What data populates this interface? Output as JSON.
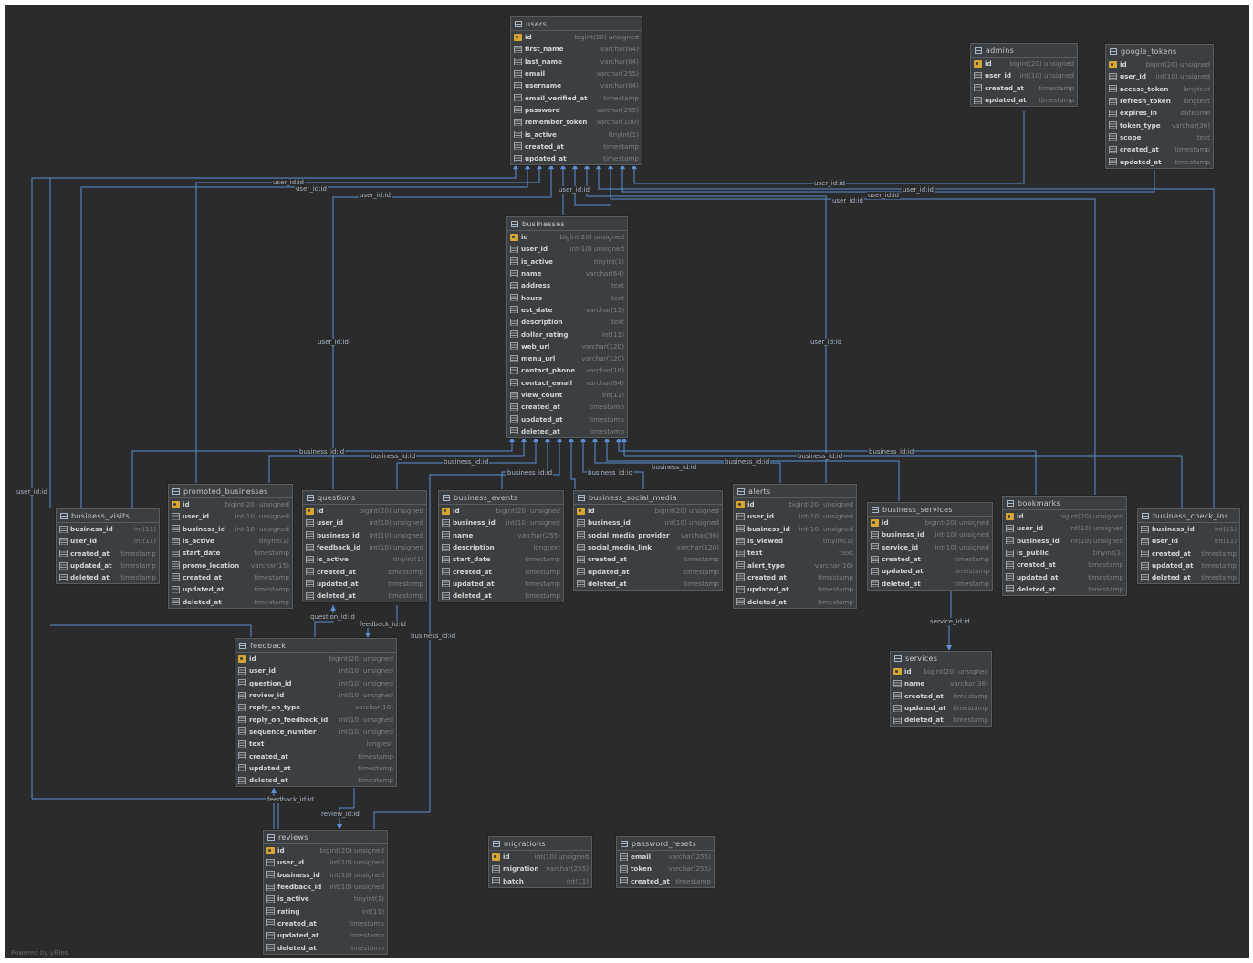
{
  "tables": [
    {
      "key": "users",
      "name": "users",
      "columns": [
        [
          "id",
          "bigint(20) unsigned"
        ],
        [
          "first_name",
          "varchar(64)"
        ],
        [
          "last_name",
          "varchar(64)"
        ],
        [
          "email",
          "varchar(255)"
        ],
        [
          "username",
          "varchar(64)"
        ],
        [
          "email_verified_at",
          "timestamp"
        ],
        [
          "password",
          "varchar(255)"
        ],
        [
          "remember_token",
          "varchar(100)"
        ],
        [
          "is_active",
          "tinyint(1)"
        ],
        [
          "created_at",
          "timestamp"
        ],
        [
          "updated_at",
          "timestamp"
        ]
      ]
    },
    {
      "key": "admins",
      "name": "admins",
      "columns": [
        [
          "id",
          "bigint(20) unsigned"
        ],
        [
          "user_id",
          "int(10) unsigned"
        ],
        [
          "created_at",
          "timestamp"
        ],
        [
          "updated_at",
          "timestamp"
        ]
      ]
    },
    {
      "key": "google_tokens",
      "name": "google_tokens",
      "columns": [
        [
          "id",
          "bigint(20) unsigned"
        ],
        [
          "user_id",
          "int(10) unsigned"
        ],
        [
          "access_token",
          "longtext"
        ],
        [
          "refresh_token",
          "longtext"
        ],
        [
          "expires_in",
          "datetime"
        ],
        [
          "token_type",
          "varchar(36)"
        ],
        [
          "scope",
          "text"
        ],
        [
          "created_at",
          "timestamp"
        ],
        [
          "updated_at",
          "timestamp"
        ]
      ]
    },
    {
      "key": "businesses",
      "name": "businesses",
      "columns": [
        [
          "id",
          "bigint(20) unsigned"
        ],
        [
          "user_id",
          "int(10) unsigned"
        ],
        [
          "is_active",
          "tinyint(1)"
        ],
        [
          "name",
          "varchar(64)"
        ],
        [
          "address",
          "text"
        ],
        [
          "hours",
          "text"
        ],
        [
          "est_date",
          "varchar(15)"
        ],
        [
          "description",
          "text"
        ],
        [
          "dollar_rating",
          "int(11)"
        ],
        [
          "web_url",
          "varchar(120)"
        ],
        [
          "menu_url",
          "varchar(120)"
        ],
        [
          "contact_phone",
          "varchar(18)"
        ],
        [
          "contact_email",
          "varchar(64)"
        ],
        [
          "view_count",
          "int(11)"
        ],
        [
          "created_at",
          "timestamp"
        ],
        [
          "updated_at",
          "timestamp"
        ],
        [
          "deleted_at",
          "timestamp"
        ]
      ]
    },
    {
      "key": "business_visits",
      "name": "business_visits",
      "columns": [
        [
          "business_id",
          "int(11)"
        ],
        [
          "user_id",
          "int(11)"
        ],
        [
          "created_at",
          "timestamp"
        ],
        [
          "updated_at",
          "timestamp"
        ],
        [
          "deleted_at",
          "timestamp"
        ]
      ]
    },
    {
      "key": "promoted_businesses",
      "name": "promoted_businesses",
      "columns": [
        [
          "id",
          "bigint(20) unsigned"
        ],
        [
          "user_id",
          "int(10) unsigned"
        ],
        [
          "business_id",
          "int(10) unsigned"
        ],
        [
          "is_active",
          "tinyint(1)"
        ],
        [
          "start_date",
          "timestamp"
        ],
        [
          "promo_location",
          "varchar(15)"
        ],
        [
          "created_at",
          "timestamp"
        ],
        [
          "updated_at",
          "timestamp"
        ],
        [
          "deleted_at",
          "timestamp"
        ]
      ]
    },
    {
      "key": "questions",
      "name": "questions",
      "columns": [
        [
          "id",
          "bigint(20) unsigned"
        ],
        [
          "user_id",
          "int(10) unsigned"
        ],
        [
          "business_id",
          "int(10) unsigned"
        ],
        [
          "feedback_id",
          "int(10) unsigned"
        ],
        [
          "is_active",
          "tinyint(1)"
        ],
        [
          "created_at",
          "timestamp"
        ],
        [
          "updated_at",
          "timestamp"
        ],
        [
          "deleted_at",
          "timestamp"
        ]
      ]
    },
    {
      "key": "business_events",
      "name": "business_events",
      "columns": [
        [
          "id",
          "bigint(20) unsigned"
        ],
        [
          "business_id",
          "int(10) unsigned"
        ],
        [
          "name",
          "varchar(255)"
        ],
        [
          "description",
          "longtext"
        ],
        [
          "start_date",
          "timestamp"
        ],
        [
          "created_at",
          "timestamp"
        ],
        [
          "updated_at",
          "timestamp"
        ],
        [
          "deleted_at",
          "timestamp"
        ]
      ]
    },
    {
      "key": "business_social_media",
      "name": "business_social_media",
      "columns": [
        [
          "id",
          "bigint(20) unsigned"
        ],
        [
          "business_id",
          "int(10) unsigned"
        ],
        [
          "social_media_provider",
          "varchar(36)"
        ],
        [
          "social_media_link",
          "varchar(120)"
        ],
        [
          "created_at",
          "timestamp"
        ],
        [
          "updated_at",
          "timestamp"
        ],
        [
          "deleted_at",
          "timestamp"
        ]
      ]
    },
    {
      "key": "alerts",
      "name": "alerts",
      "columns": [
        [
          "id",
          "bigint(20) unsigned"
        ],
        [
          "user_id",
          "int(10) unsigned"
        ],
        [
          "business_id",
          "int(10) unsigned"
        ],
        [
          "is_viewed",
          "tinyint(1)"
        ],
        [
          "text",
          "text"
        ],
        [
          "alert_type",
          "varchar(16)"
        ],
        [
          "created_at",
          "timestamp"
        ],
        [
          "updated_at",
          "timestamp"
        ],
        [
          "deleted_at",
          "timestamp"
        ]
      ]
    },
    {
      "key": "business_services",
      "name": "business_services",
      "columns": [
        [
          "id",
          "bigint(20) unsigned"
        ],
        [
          "business_id",
          "int(10) unsigned"
        ],
        [
          "service_id",
          "int(10) unsigned"
        ],
        [
          "created_at",
          "timestamp"
        ],
        [
          "updated_at",
          "timestamp"
        ],
        [
          "deleted_at",
          "timestamp"
        ]
      ]
    },
    {
      "key": "bookmarks",
      "name": "bookmarks",
      "columns": [
        [
          "id",
          "bigint(20) unsigned"
        ],
        [
          "user_id",
          "int(10) unsigned"
        ],
        [
          "business_id",
          "int(10) unsigned"
        ],
        [
          "is_public",
          "tinyint(1)"
        ],
        [
          "created_at",
          "timestamp"
        ],
        [
          "updated_at",
          "timestamp"
        ],
        [
          "deleted_at",
          "timestamp"
        ]
      ]
    },
    {
      "key": "business_check_ins",
      "name": "business_check_ins",
      "columns": [
        [
          "business_id",
          "int(11)"
        ],
        [
          "user_id",
          "int(11)"
        ],
        [
          "created_at",
          "timestamp"
        ],
        [
          "updated_at",
          "timestamp"
        ],
        [
          "deleted_at",
          "timestamp"
        ]
      ]
    },
    {
      "key": "services",
      "name": "services",
      "columns": [
        [
          "id",
          "bigint(20) unsigned"
        ],
        [
          "name",
          "varchar(36)"
        ],
        [
          "created_at",
          "timestamp"
        ],
        [
          "updated_at",
          "timestamp"
        ],
        [
          "deleted_at",
          "timestamp"
        ]
      ]
    },
    {
      "key": "feedback",
      "name": "feedback",
      "columns": [
        [
          "id",
          "bigint(20) unsigned"
        ],
        [
          "user_id",
          "int(10) unsigned"
        ],
        [
          "question_id",
          "int(10) unsigned"
        ],
        [
          "review_id",
          "int(10) unsigned"
        ],
        [
          "reply_on_type",
          "varchar(18)"
        ],
        [
          "reply_on_feedback_id",
          "int(10) unsigned"
        ],
        [
          "sequence_number",
          "int(10) unsigned"
        ],
        [
          "text",
          "longtext"
        ],
        [
          "created_at",
          "timestamp"
        ],
        [
          "updated_at",
          "timestamp"
        ],
        [
          "deleted_at",
          "timestamp"
        ]
      ]
    },
    {
      "key": "reviews",
      "name": "reviews",
      "columns": [
        [
          "id",
          "bigint(20) unsigned"
        ],
        [
          "user_id",
          "int(10) unsigned"
        ],
        [
          "business_id",
          "int(10) unsigned"
        ],
        [
          "feedback_id",
          "int(10) unsigned"
        ],
        [
          "is_active",
          "tinyint(1)"
        ],
        [
          "rating",
          "int(11)"
        ],
        [
          "created_at",
          "timestamp"
        ],
        [
          "updated_at",
          "timestamp"
        ],
        [
          "deleted_at",
          "timestamp"
        ]
      ]
    },
    {
      "key": "migrations",
      "name": "migrations",
      "columns": [
        [
          "id",
          "int(10) unsigned"
        ],
        [
          "migration",
          "varchar(255)"
        ],
        [
          "batch",
          "int(11)"
        ]
      ]
    },
    {
      "key": "password_resets",
      "name": "password_resets",
      "columns": [
        [
          "email",
          "varchar(255)"
        ],
        [
          "token",
          "varchar(255)"
        ],
        [
          "created_at",
          "timestamp"
        ]
      ]
    }
  ],
  "edge_labels": {
    "user_id": "user_id:id",
    "business_id": "business_id:id",
    "question_id": "question_id:id",
    "feedback_id": "feedback_id:id",
    "review_id": "review_id:id",
    "service_id": "service_id:id"
  },
  "footer": "Powered by yFiles",
  "colors": {
    "edge": "#5b8fd6",
    "background": "#2b2b2b",
    "table": "#3c3f41",
    "key_icon": "#d6a532"
  }
}
